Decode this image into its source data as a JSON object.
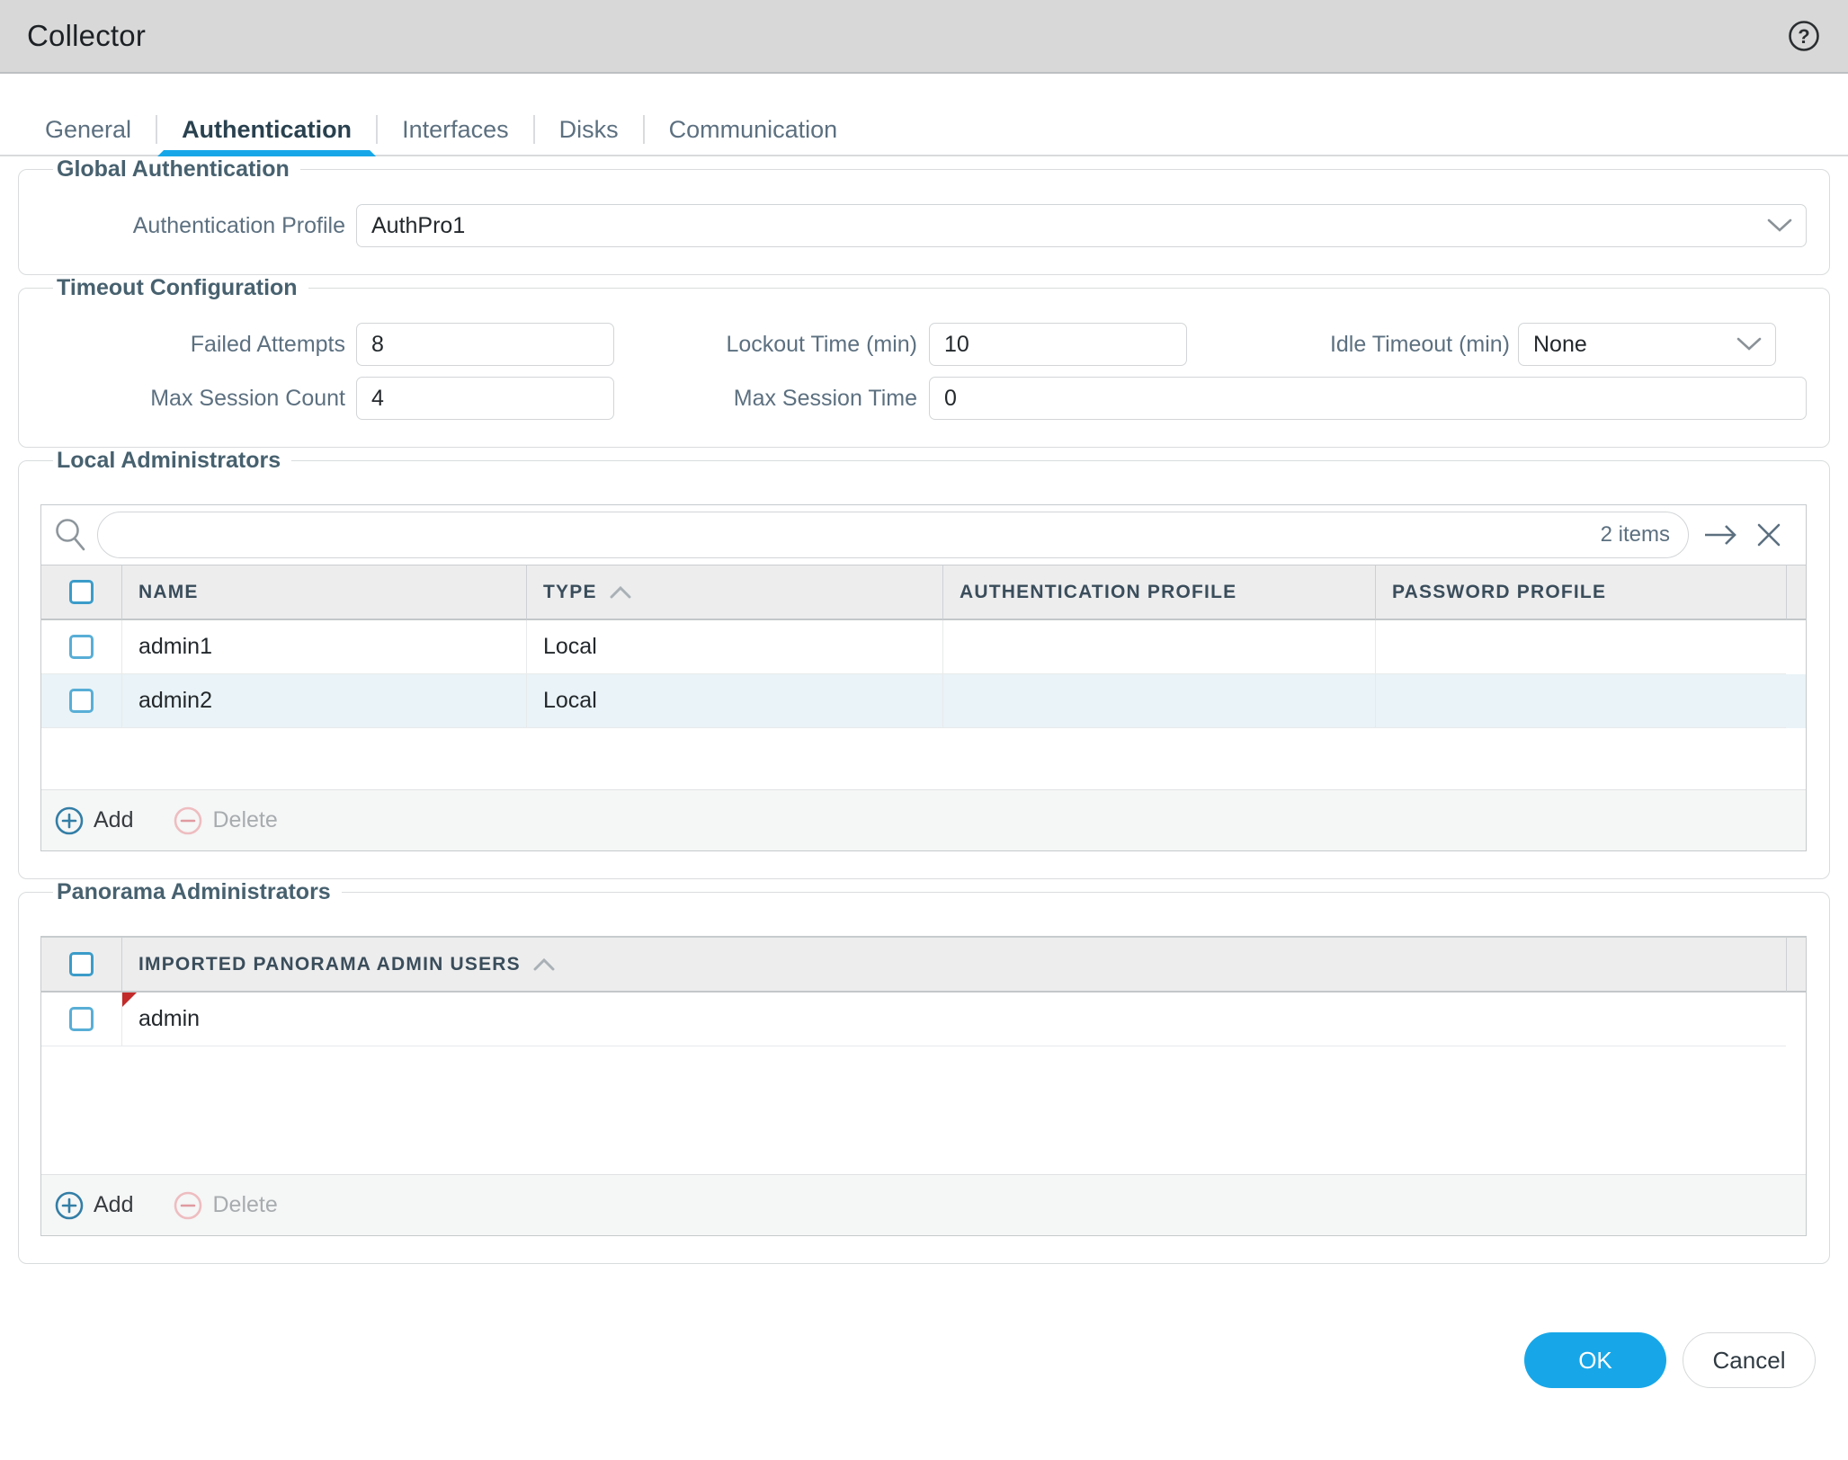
{
  "window": {
    "title": "Collector"
  },
  "tabs": [
    {
      "label": "General"
    },
    {
      "label": "Authentication"
    },
    {
      "label": "Interfaces"
    },
    {
      "label": "Disks"
    },
    {
      "label": "Communication"
    }
  ],
  "active_tab": "Authentication",
  "global_auth": {
    "legend": "Global Authentication",
    "profile_label": "Authentication Profile",
    "profile_value": "AuthPro1"
  },
  "timeout": {
    "legend": "Timeout Configuration",
    "failed_attempts": {
      "label": "Failed Attempts",
      "value": "8"
    },
    "lockout_time": {
      "label": "Lockout Time (min)",
      "value": "10"
    },
    "idle_timeout": {
      "label": "Idle Timeout (min)",
      "value": "None"
    },
    "max_session_count": {
      "label": "Max Session Count",
      "value": "4"
    },
    "max_session_time": {
      "label": "Max Session Time",
      "value": "0"
    }
  },
  "local_admins": {
    "legend": "Local Administrators",
    "items_count": "2 items",
    "columns": [
      "NAME",
      "TYPE",
      "AUTHENTICATION PROFILE",
      "PASSWORD PROFILE"
    ],
    "rows": [
      {
        "name": "admin1",
        "type": "Local",
        "auth_profile": "",
        "password_profile": ""
      },
      {
        "name": "admin2",
        "type": "Local",
        "auth_profile": "",
        "password_profile": ""
      }
    ],
    "add_label": "Add",
    "delete_label": "Delete"
  },
  "panorama_admins": {
    "legend": "Panorama Administrators",
    "column": "IMPORTED PANORAMA ADMIN USERS",
    "rows": [
      {
        "name": "admin",
        "flagged": true
      }
    ],
    "add_label": "Add",
    "delete_label": "Delete"
  },
  "footer": {
    "ok": "OK",
    "cancel": "Cancel"
  },
  "colors": {
    "accent": "#17a7e8",
    "titlebar_bg": "#d8d8d8",
    "legend_text": "#47616f",
    "label_text": "#5c7080",
    "row_alt": "#eaf3f7",
    "checkbox_blue": "#58aed6",
    "delete_pink": "#eebdc0",
    "flag_red": "#c32b2b"
  }
}
